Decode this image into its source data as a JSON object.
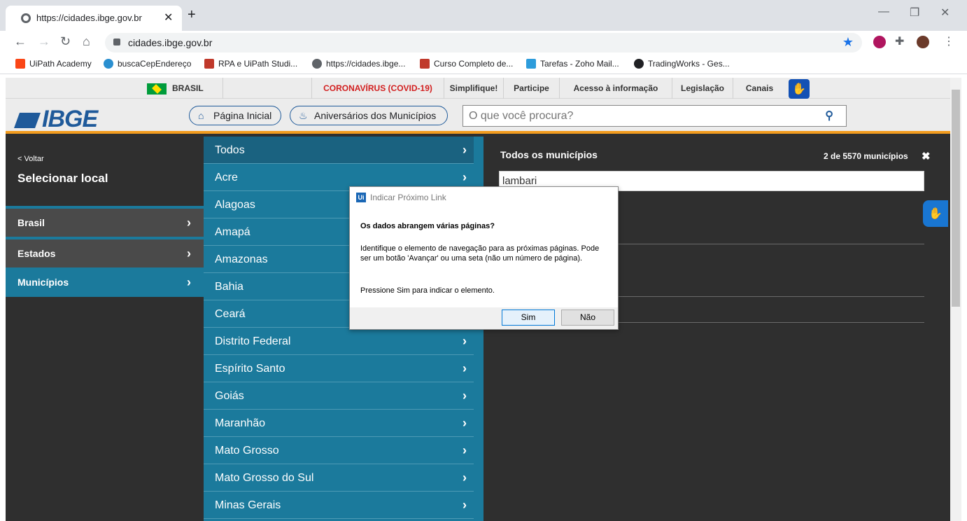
{
  "browser": {
    "tab_title": "https://cidades.ibge.gov.br",
    "tab_close": "✕",
    "new_tab": "+",
    "url": "cidades.ibge.gov.br",
    "bookmarks": [
      "UiPath Academy",
      "buscaCepEndereço",
      "RPA e UiPath Studi...",
      "https://cidades.ibge...",
      "Curso Completo de...",
      "Tarefas - Zoho Mail...",
      "TradingWorks - Ges..."
    ]
  },
  "gov_bar": {
    "brasil": "BRASIL",
    "covid": "CORONAVÍRUS (COVID-19)",
    "links": [
      "Simplifique!",
      "Participe",
      "Acesso à informação",
      "Legislação",
      "Canais"
    ]
  },
  "header": {
    "logo": "IBGE",
    "home": "Página Inicial",
    "aniversarios": "Aniversários dos Municípios",
    "search_placeholder": "O que você procura?"
  },
  "left_panel": {
    "back": "< Voltar",
    "title": "Selecionar local",
    "items": [
      "Brasil",
      "Estados",
      "Municípios"
    ]
  },
  "states": [
    "Todos",
    "Acre",
    "Alagoas",
    "Amapá",
    "Amazonas",
    "Bahia",
    "Ceará",
    "Distrito Federal",
    "Espírito Santo",
    "Goiás",
    "Maranhão",
    "Mato Grosso",
    "Mato Grosso do Sul",
    "Minas Gerais"
  ],
  "right_panel": {
    "title": "Todos os municípios",
    "count": "2 de 5570 municípios",
    "search_value": "lambari"
  },
  "dialog": {
    "logo": "Ui",
    "title": "Indicar Próximo Link",
    "question": "Os dados abrangem várias páginas?",
    "description": "Identifique o elemento de navegação para as próximas páginas. Pode ser um botão 'Avançar' ou uma seta (não um número de página).",
    "instruction": "Pressione Sim para indicar o elemento.",
    "yes": "Sim",
    "no": "Não"
  },
  "colors": {
    "ibge_blue": "#1f5a9a",
    "state_list_bg": "#1b7a9c",
    "accent_orange": "#f29c1f",
    "covid_red": "#d21f1f"
  }
}
